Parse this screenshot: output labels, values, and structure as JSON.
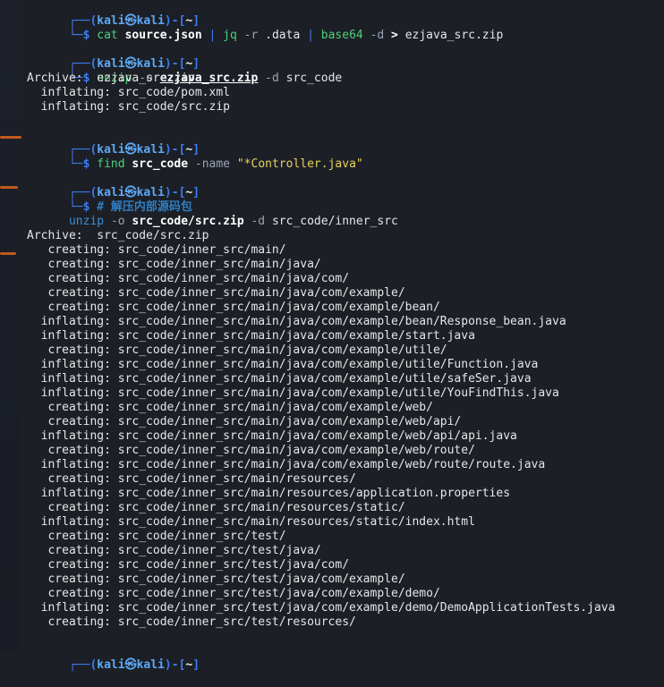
{
  "prompt": {
    "user_host_left": "┌──(",
    "user": "kali",
    "at": "㉿",
    "host": "kali",
    "mid": ")-[",
    "dir": "~",
    "right": "]",
    "cmd_prefix": "└─$ "
  },
  "blocks": [
    {
      "command": {
        "cmd": "cat",
        "arg1": "source.json",
        "pipe1": "|",
        "cmd2": "jq",
        "opt2": "-r",
        "arg2": ".data",
        "pipe2": "|",
        "cmd3": "base64",
        "opt3": "-d",
        "redir": ">",
        "arg3": "ezjava_src.zip"
      }
    },
    {
      "command": {
        "cmd": "unzip",
        "opt1": "-o",
        "arg1": "ezjava_src.zip",
        "opt2": "-d",
        "arg2": "src_code"
      },
      "output": [
        "Archive:  ezjava_src.zip",
        "  inflating: src_code/pom.xml",
        "  inflating: src_code/src.zip"
      ]
    },
    {
      "command": {
        "cmd": "find",
        "arg1": "src_code",
        "opt1": "-name",
        "str1": "\"*Controller.java\""
      }
    },
    {
      "comment": "# 解压内部源码包",
      "cont": {
        "cmd": "unzip",
        "opt1": "-o",
        "arg1": "src_code/src.zip",
        "opt2": "-d",
        "arg2": "src_code/inner_src"
      },
      "output": [
        "Archive:  src_code/src.zip",
        "   creating: src_code/inner_src/main/",
        "   creating: src_code/inner_src/main/java/",
        "   creating: src_code/inner_src/main/java/com/",
        "   creating: src_code/inner_src/main/java/com/example/",
        "   creating: src_code/inner_src/main/java/com/example/bean/",
        "  inflating: src_code/inner_src/main/java/com/example/bean/Response_bean.java",
        "  inflating: src_code/inner_src/main/java/com/example/start.java",
        "   creating: src_code/inner_src/main/java/com/example/utile/",
        "  inflating: src_code/inner_src/main/java/com/example/utile/Function.java",
        "  inflating: src_code/inner_src/main/java/com/example/utile/safeSer.java",
        "  inflating: src_code/inner_src/main/java/com/example/utile/YouFindThis.java",
        "   creating: src_code/inner_src/main/java/com/example/web/",
        "   creating: src_code/inner_src/main/java/com/example/web/api/",
        "  inflating: src_code/inner_src/main/java/com/example/web/api/api.java",
        "   creating: src_code/inner_src/main/java/com/example/web/route/",
        "  inflating: src_code/inner_src/main/java/com/example/web/route/route.java",
        "   creating: src_code/inner_src/main/resources/",
        "  inflating: src_code/inner_src/main/resources/application.properties",
        "   creating: src_code/inner_src/main/resources/static/",
        "  inflating: src_code/inner_src/main/resources/static/index.html",
        "   creating: src_code/inner_src/test/",
        "   creating: src_code/inner_src/test/java/",
        "   creating: src_code/inner_src/test/java/com/",
        "   creating: src_code/inner_src/test/java/com/example/",
        "   creating: src_code/inner_src/test/java/com/example/demo/",
        "  inflating: src_code/inner_src/test/java/com/example/demo/DemoApplicationTests.java",
        "   creating: src_code/inner_src/test/resources/"
      ]
    }
  ],
  "colors": {
    "prompt_blue": "#3a7df0",
    "command_green": "#4fd07a",
    "string_yellow": "#e6d35a",
    "comment_blue": "#2f7ec4",
    "accent_orange": "#e0631b"
  }
}
